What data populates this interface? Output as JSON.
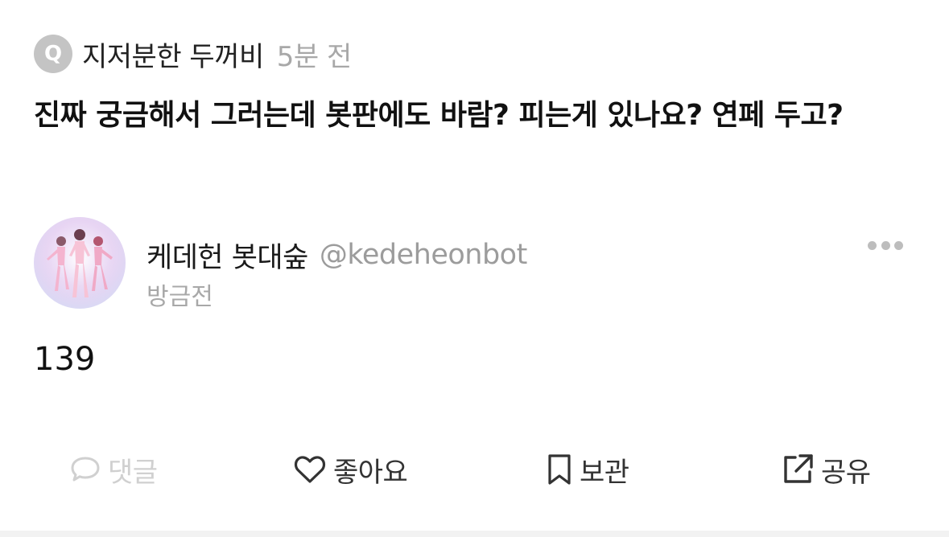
{
  "question": {
    "badge": "Q",
    "author": "지저분한 두꺼비",
    "time": "5분 전",
    "text": "진짜 궁금해서 그러는데 봇판에도 바람? 피는게 있나요? 연페 두고?"
  },
  "answer": {
    "name": "케데헌 봇대숲",
    "handle": "@kedeheonbot",
    "time": "방금전",
    "body": "139",
    "avatar_icon": "avatar-image"
  },
  "actions": {
    "comment": {
      "label": "댓글",
      "icon": "comment-icon"
    },
    "like": {
      "label": "좋아요",
      "icon": "heart-icon"
    },
    "save": {
      "label": "보관",
      "icon": "bookmark-icon"
    },
    "share": {
      "label": "공유",
      "icon": "share-icon"
    }
  },
  "colors": {
    "text": "#111111",
    "muted": "#a8a8a8",
    "disabled": "#d0d0d0",
    "badge": "#c4c4c4"
  }
}
